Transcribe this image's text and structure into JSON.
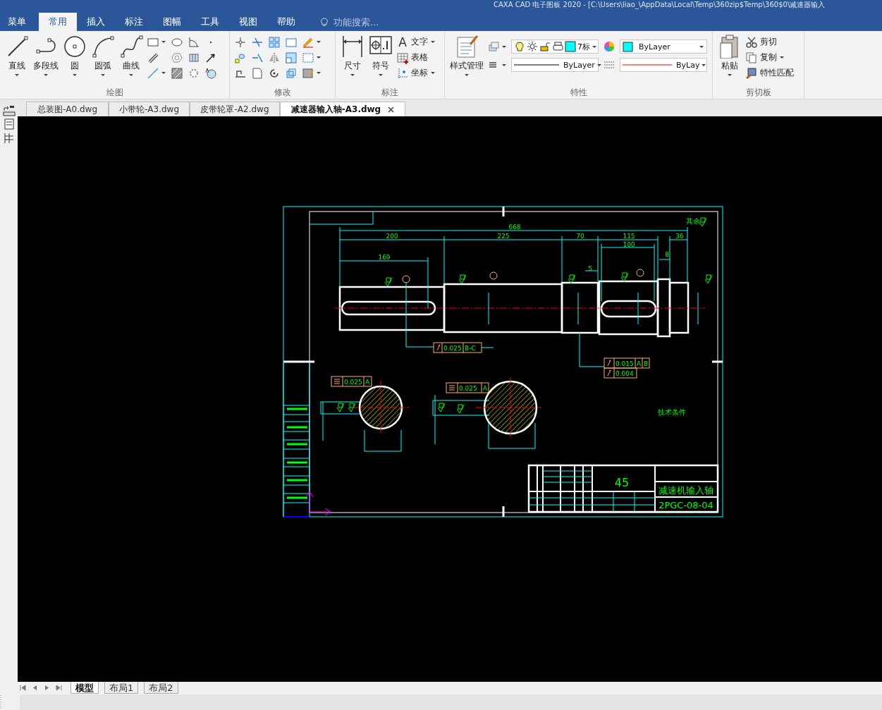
{
  "window": {
    "title": "CAXA CAD 电子图板 2020 - [C:\\Users\\liao_\\AppData\\Local\\Temp\\360zip$Temp\\360$0\\减速器输入"
  },
  "menu_button": "菜单",
  "ribbon_tabs": [
    {
      "label": "常用",
      "selected": true
    },
    {
      "label": "插入",
      "selected": false
    },
    {
      "label": "标注",
      "selected": false
    },
    {
      "label": "图幅",
      "selected": false
    },
    {
      "label": "工具",
      "selected": false
    },
    {
      "label": "视图",
      "selected": false
    },
    {
      "label": "帮助",
      "selected": false
    }
  ],
  "search": {
    "placeholder": "功能搜索..."
  },
  "ribbon_groups": [
    {
      "kind": "draw",
      "title": "绘图",
      "tools": [
        "直线",
        "多段线",
        "圆",
        "圆弧",
        "曲线"
      ]
    },
    {
      "kind": "modify",
      "title": "修改"
    },
    {
      "kind": "annotate",
      "title": "标注",
      "tools": [
        "尺寸",
        "符号"
      ],
      "text_glyph": "A",
      "small_tools": [
        "文字",
        "表格",
        "坐标"
      ]
    },
    {
      "kind": "properties",
      "title": "特性",
      "tools": [
        "样式管理"
      ],
      "layer": "7标",
      "color_setting": "ByLayer",
      "linetype": "ByLayer",
      "lineweight": "ByLay"
    },
    {
      "kind": "clipboard",
      "title": "剪切板",
      "tools": [
        "粘贴"
      ],
      "small_tools": [
        "剪切",
        "复制",
        "特性匹配"
      ]
    }
  ],
  "doc_tabs": [
    {
      "label": "总装图-A0.dwg",
      "selected": false
    },
    {
      "label": "小带轮-A3.dwg",
      "selected": false
    },
    {
      "label": "皮带轮罩-A2.dwg",
      "selected": false
    },
    {
      "label": "减速器输入轴-A3.dwg",
      "selected": true
    }
  ],
  "drawing": {
    "dimension_labels": [
      "668",
      "200",
      "225",
      "70",
      "115",
      "100",
      "36",
      "169",
      "5",
      "8"
    ],
    "roughness_note": "其余",
    "tolerances": [
      {
        "cells": [
          "0.025",
          "B-C"
        ]
      },
      {
        "cells": [
          "0.015",
          "A",
          "B"
        ]
      },
      {
        "cells": [
          "0.004"
        ]
      },
      {
        "cells": [
          "0.025",
          "A"
        ]
      },
      {
        "cells": [
          "0.025",
          "A"
        ]
      }
    ],
    "tech_title": "技术条件",
    "title_block": {
      "material": "45",
      "name": "减速机输入轴",
      "code": "2PGC-08-04"
    }
  },
  "layout_tabs": [
    {
      "label": "模型",
      "selected": true
    },
    {
      "label": "布局1",
      "selected": false
    },
    {
      "label": "布局2",
      "selected": false
    }
  ]
}
